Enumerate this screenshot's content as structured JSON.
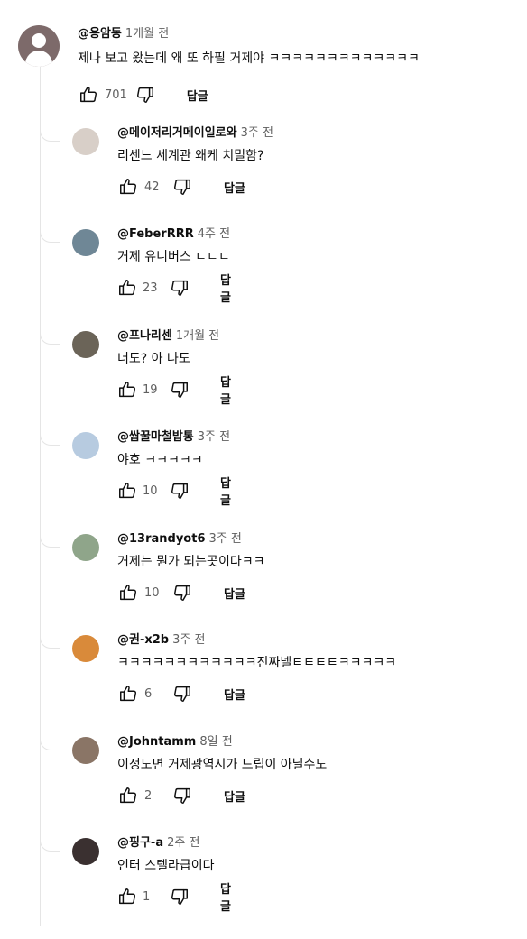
{
  "top_comment": {
    "author": "@용암동",
    "time": "1개월 전",
    "text": "제나 보고 왔는데 왜 또 하필 거제야 ㅋㅋㅋㅋㅋㅋㅋㅋㅋㅋㅋㅋㅋ",
    "likes": "701",
    "reply_label": "답글"
  },
  "replies": [
    {
      "author": "@메이저리거메이일로와",
      "time": "3주 전",
      "text": "리센느 세계관 왜케 치밀함?",
      "likes": "42",
      "reply_label": "답글",
      "avatar_color": "#d8cfc8"
    },
    {
      "author": "@FeberRRR",
      "time": "4주 전",
      "text": "거제 유니버스 ㄷㄷㄷ",
      "likes": "23",
      "reply_label": "답글",
      "avatar_color": "#6f8796"
    },
    {
      "author": "@프나리센",
      "time": "1개월 전",
      "text": "너도? 아 나도",
      "likes": "19",
      "reply_label": "답글",
      "avatar_color": "#6b6458"
    },
    {
      "author": "@쌉꿀마철밥통",
      "time": "3주 전",
      "text": "야호 ㅋㅋㅋㅋㅋ",
      "likes": "10",
      "reply_label": "답글",
      "avatar_color": "#b7cbe0"
    },
    {
      "author": "@13randyot6",
      "time": "3주 전",
      "text": "거제는 뭔가 되는곳이다ㅋㅋ",
      "likes": "10",
      "reply_label": "답글",
      "avatar_color": "#8fa58a"
    },
    {
      "author": "@권-x2b",
      "time": "3주 전",
      "text": "ㅋㅋㅋㅋㅋㅋㅋㅋㅋㅋㅋㅋ진짜넬ㅌㅌㅌㅌㅋㅋㅋㅋㅋ",
      "likes": "6",
      "reply_label": "답글",
      "avatar_color": "#d98a3a"
    },
    {
      "author": "@Johntamm",
      "time": "8일 전",
      "text": "이정도면 거제광역시가 드립이 아닐수도",
      "likes": "2",
      "reply_label": "답글",
      "avatar_color": "#8a7566"
    },
    {
      "author": "@핑구-a",
      "time": "2주 전",
      "text": "인터 스텔라급이다",
      "likes": "1",
      "reply_label": "답글",
      "avatar_color": "#3a3030"
    }
  ],
  "icons": {
    "like": "thumbs-up-icon",
    "dislike": "thumbs-down-icon"
  },
  "colors": {
    "meta_gray": "#606060",
    "text": "#0f0f0f",
    "thread_line": "#e5e5e5"
  }
}
